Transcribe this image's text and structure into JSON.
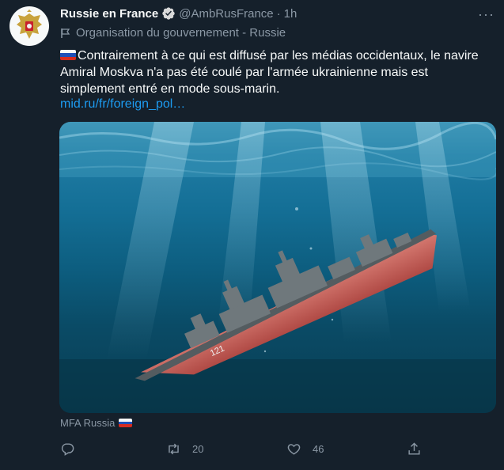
{
  "account": {
    "name": "Russie en France",
    "handle": "@AmbRusFrance",
    "separator": "·",
    "time": "1h",
    "label": "Organisation du gouvernement - Russie"
  },
  "tweet": {
    "text": "Contrairement à ce qui est diffusé par les médias occidentaux, le navire Amiral Moskva n'a pas été coulé par l'armée ukrainienne mais est simplement entré en mode sous-marin.",
    "link": "mid.ru/fr/foreign_pol…"
  },
  "media": {
    "hull_number": "121",
    "credit": "MFA Russia"
  },
  "actions": {
    "replies": "",
    "retweets": "20",
    "likes": "46"
  },
  "colors": {
    "background": "#15202b",
    "secondary_text": "#8b98a5",
    "link": "#1d9bf0",
    "verified": "#d9d9d9"
  },
  "icons": [
    "avatar-emblem-icon",
    "verified-icon",
    "more-icon",
    "flag-icon",
    "reply-icon",
    "retweet-icon",
    "like-icon",
    "share-icon"
  ]
}
